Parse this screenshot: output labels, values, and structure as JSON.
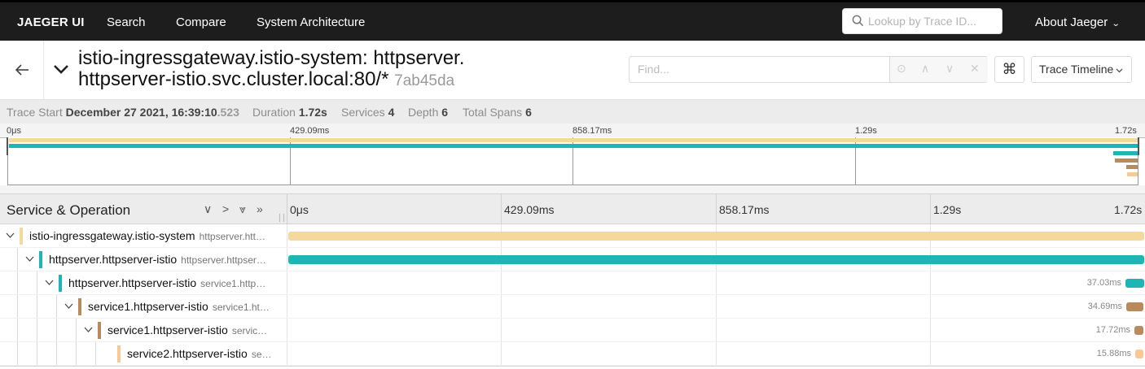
{
  "nav": {
    "brand": "JAEGER UI",
    "items": [
      "Search",
      "Compare",
      "System Architecture"
    ],
    "lookup_placeholder": "Lookup by Trace ID...",
    "about": "About Jaeger"
  },
  "trace": {
    "title_line1": "istio-ingressgateway.istio-system: httpserver.",
    "title_line2": "httpserver-istio.svc.cluster.local:80/*",
    "trace_id": "7ab45da",
    "find_placeholder": "Find...",
    "view_mode": "Trace Timeline"
  },
  "summary": {
    "start_label": "Trace Start",
    "start_value": "December 27 2021, 16:39:10",
    "start_ms": ".523",
    "duration_label": "Duration",
    "duration_value": "1.72s",
    "services_label": "Services",
    "services_value": "4",
    "depth_label": "Depth",
    "depth_value": "6",
    "spans_label": "Total Spans",
    "spans_value": "6"
  },
  "ticks": [
    "0μs",
    "429.09ms",
    "858.17ms",
    "1.29s",
    "1.72s"
  ],
  "timeline": {
    "column_title": "Service & Operation"
  },
  "colors": {
    "ingress": "#f5d89b",
    "httpserver": "#1fb5b5",
    "service1": "#b88a5c",
    "service2": "#f9c993"
  },
  "spans": [
    {
      "service": "istio-ingressgateway.istio-system",
      "operation": "httpserver.htt…",
      "depth": 0,
      "color": "#f5d89b",
      "start": 0.0,
      "fraction": 1.0,
      "duration": ""
    },
    {
      "service": "httpserver.httpserver-istio",
      "operation": "httpserver.httpser…",
      "depth": 1,
      "color": "#1fb5b5",
      "start": 0.0,
      "fraction": 1.0,
      "duration": ""
    },
    {
      "service": "httpserver.httpserver-istio",
      "operation": "service1.http…",
      "depth": 2,
      "color": "#1fb5b5",
      "start": 0.978,
      "fraction": 0.0215,
      "duration": "37.03ms"
    },
    {
      "service": "service1.httpserver-istio",
      "operation": "service1.ht…",
      "depth": 3,
      "color": "#b88a5c",
      "start": 0.979,
      "fraction": 0.0202,
      "duration": "34.69ms"
    },
    {
      "service": "service1.httpserver-istio",
      "operation": "servic…",
      "depth": 4,
      "color": "#b88a5c",
      "start": 0.9885,
      "fraction": 0.0103,
      "duration": "17.72ms"
    },
    {
      "service": "service2.httpserver-istio",
      "operation": "se…",
      "depth": 5,
      "color": "#f9c993",
      "start": 0.9895,
      "fraction": 0.0092,
      "duration": "15.88ms"
    }
  ]
}
